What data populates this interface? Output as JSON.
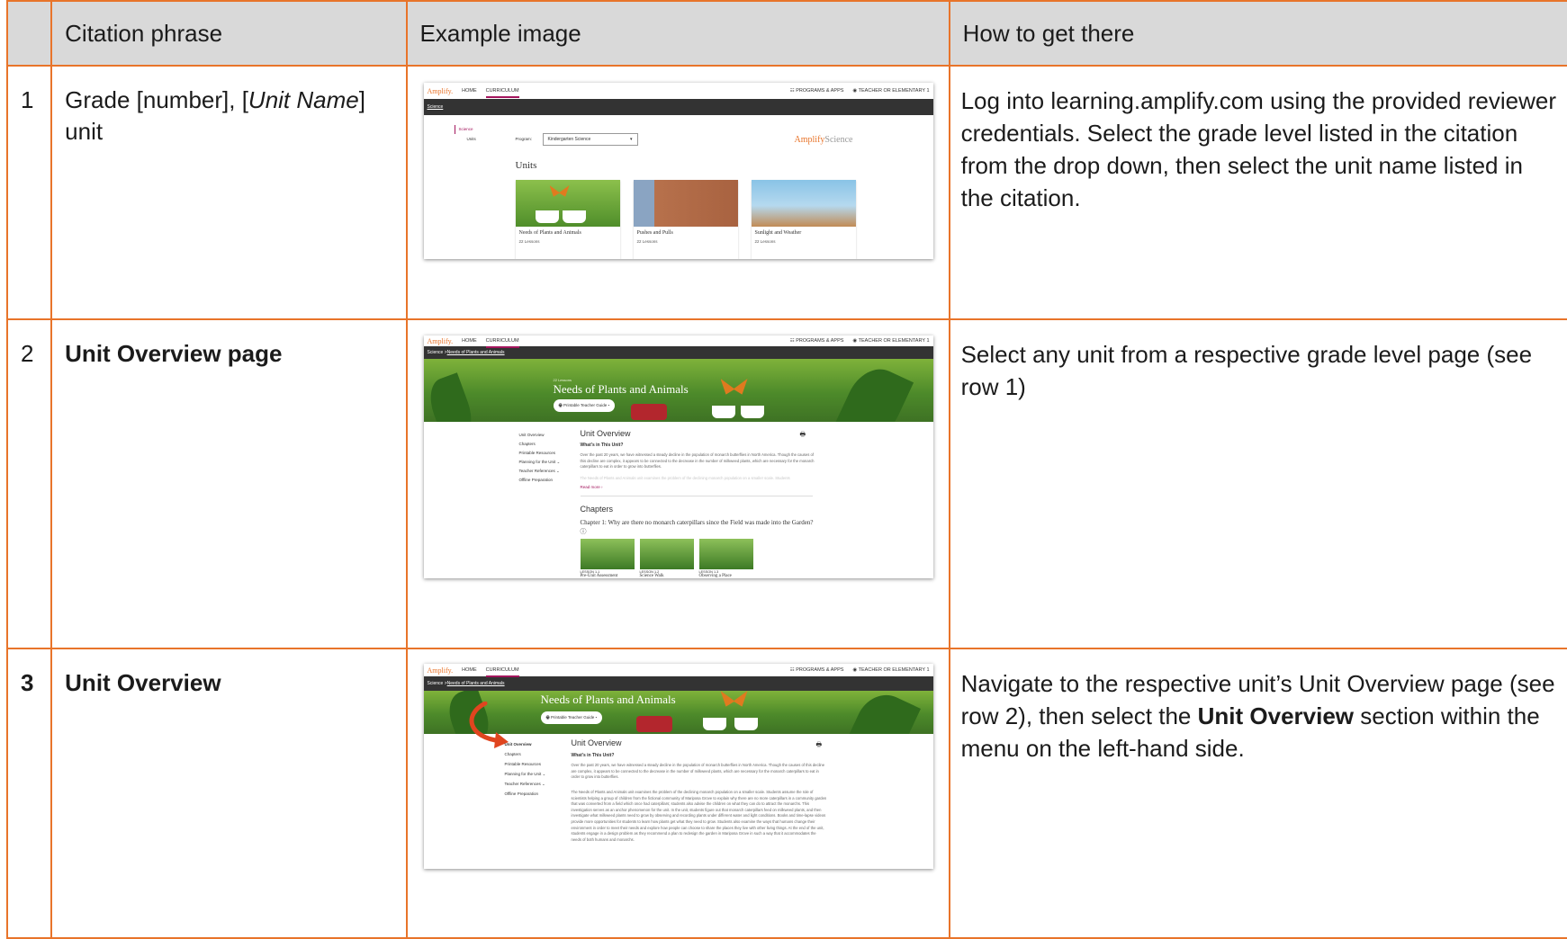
{
  "headers": [
    "",
    "Citation phrase",
    "Example image",
    "How to get there"
  ],
  "rows": [
    {
      "num": "1",
      "phrase_a": "Grade [number], [",
      "phrase_b": "Unit Name",
      "phrase_c": "] unit",
      "how": "Log into learning.amplify.com using the provided reviewer credentials. Select the grade level listed in the citation from the drop down, then select the unit name listed in the citation."
    },
    {
      "num": "2",
      "phrase": "Unit Overview page",
      "how": "Select any unit from a respective grade level page (see row 1)"
    },
    {
      "num": "3",
      "phrase": "Unit Overview",
      "how_a": "Navigate to the respective unit’s Unit Overview page (see row 2), then select the ",
      "how_b": "Unit Overview",
      "how_c": " section within the menu on the left-hand side."
    }
  ],
  "shot_common": {
    "logo": "Amplify.",
    "nav_home": "HOME",
    "nav_curriculum": "CURRICULUM",
    "programs": "☷ PROGRAMS & APPS",
    "teacher": "◉ TEACHER OR ELEMENTARY 1"
  },
  "shot1": {
    "breadcrumb": "Science",
    "side_science": "Science",
    "side_units": "Units",
    "program_label": "Program:",
    "program_value": "Kindergarten Science",
    "brand_a": "Amplify",
    "brand_b": "Science",
    "units_heading": "Units",
    "cards": [
      {
        "title": "Needs of Plants and Animals",
        "lessons": "22 Lessons"
      },
      {
        "title": "Pushes and Pulls",
        "lessons": "22 Lessons"
      },
      {
        "title": "Sunlight and Weather",
        "lessons": "22 Lessons"
      }
    ]
  },
  "shot2": {
    "breadcrumb_a": "Science  >  ",
    "breadcrumb_b": "Needs of Plants and Animals",
    "lessons_small": "22 Lessons",
    "hero_title": "Needs of Plants and Animals",
    "guide_button": "🖶 Printable Teacher Guide  ▾",
    "menu": [
      "Unit Overview",
      "Chapters",
      "Printable Resources",
      "Planning for the Unit ⌄",
      "Teacher References ⌄",
      "Offline Preparation"
    ],
    "section_title": "Unit Overview",
    "whats_in": "What’s in This Unit?",
    "para1": "Over the past 20 years, we have witnessed a steady decline in the population of monarch butterflies in North America. Though the causes of this decline are complex, it appears to be connected to the decrease in the number of milkweed plants, which are necessary for the monarch caterpillars to eat in order to grow into butterflies.",
    "para_faded": "The Needs of Plants and Animals unit examines the problem of the declining monarch population on a smaller scale. Students",
    "read_more": "Read more  ›",
    "chapters_title": "Chapters",
    "chapter1": "Chapter 1: Why are there no monarch caterpillars since the Field was made into the Garden?  ⓘ",
    "lessons": [
      {
        "label": "LESSON 1.1",
        "title": "Pre-Unit Assessment"
      },
      {
        "label": "LESSON 1.2",
        "title": "Science Walk"
      },
      {
        "label": "LESSON 1.3",
        "title": "Observing a Place"
      }
    ]
  },
  "shot3": {
    "breadcrumb_a": "Science  >  ",
    "breadcrumb_b": "Needs of Plants and Animals",
    "hero_title": "Needs of Plants and Animals",
    "guide_button": "🖶 Printable Teacher Guide  ▾",
    "menu": [
      "Unit Overview",
      "Chapters",
      "Printable Resources",
      "Planning for the Unit ⌄",
      "Teacher References ⌄",
      "Offline Preparation"
    ],
    "section_title": "Unit Overview",
    "whats_in": "What’s in This Unit?",
    "para1": "Over the past 20 years, we have witnessed a steady decline in the population of monarch butterflies in North America. Though the causes of this decline are complex, it appears to be connected to the decrease in the number of milkweed plants, which are necessary for the monarch caterpillars to eat in order to grow into butterflies.",
    "para2": "The Needs of Plants and Animals unit examines the problem of the declining monarch population on a smaller scale. Students assume the role of scientists helping a group of children from the fictional community of Mariposa Grove to explain why there are no more caterpillars in a community garden that was converted from a field which once had caterpillars; students also advise the children on what they can do to attract the monarchs. This investigation serves as an anchor phenomenon for the unit. In the unit, students figure out that monarch caterpillars feed on milkweed plants, and then investigate what milkweed plants need to grow by observing and recording plants under different water and light conditions. Books and time-lapse videos provide more opportunities for students to learn how plants get what they need to grow. Students also examine the ways that humans change their environment in order to meet their needs and explore how people can choose to share the places they live with other living things. At the end of the unit, students engage in a design problem as they recommend a plan to redesign the garden in Mariposa Grove in such a way that it accommodates the needs of both humans and monarchs."
  },
  "colors": {
    "border": "#e8742a",
    "header_bg": "#d9d9d9",
    "brand_orange": "#e8742a",
    "accent_magenta": "#a3155d"
  }
}
